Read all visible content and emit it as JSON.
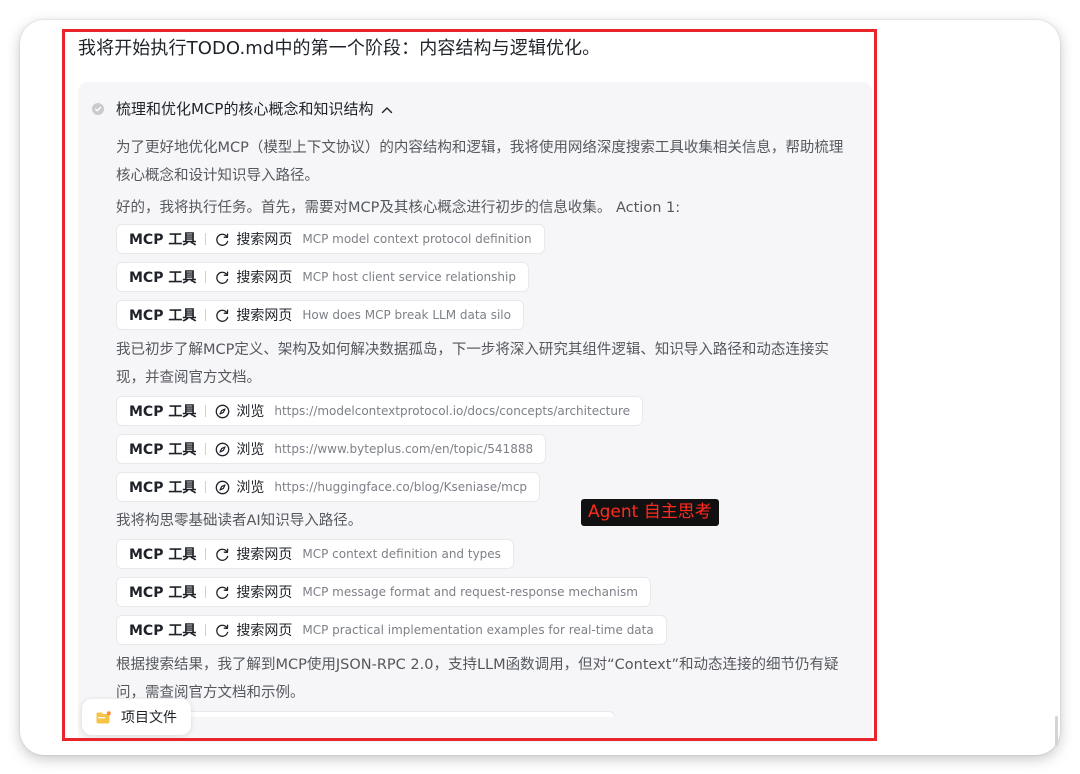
{
  "intro": "我将开始执行TODO.md中的第一个阶段：内容结构与逻辑优化。",
  "section": {
    "title": "梳理和优化MCP的核心概念和知识结构"
  },
  "paragraphs": {
    "p1": "为了更好地优化MCP（模型上下文协议）的内容结构和逻辑，我将使用网络深度搜索工具收集相关信息，帮助梳理核心概念和设计知识导入路径。",
    "p2": "好的，我将执行任务。首先，需要对MCP及其核心概念进行初步的信息收集。 Action 1:",
    "p3": "我已初步了解MCP定义、架构及如何解决数据孤岛，下一步将深入研究其组件逻辑、知识导入路径和动态连接实现，并查阅官方文档。",
    "p4": "我将构思零基础读者AI知识导入路径。",
    "p5": "根据搜索结果，我了解到MCP使用JSON-RPC 2.0，支持LLM函数调用，但对“Context”和动态连接的细节仍有疑问，需查阅官方文档和示例。"
  },
  "chips": {
    "source": "MCP 工具",
    "search_action": "搜索网页",
    "browse_action": "浏览",
    "search_icon": "refresh-search-icon",
    "browse_icon": "compass-icon",
    "group1": [
      {
        "query": "MCP model context protocol definition"
      },
      {
        "query": "MCP host client service relationship"
      },
      {
        "query": "How does MCP break LLM data silo"
      }
    ],
    "group2": [
      {
        "query": "https://modelcontextprotocol.io/docs/concepts/architecture"
      },
      {
        "query": "https://www.byteplus.com/en/topic/541888"
      },
      {
        "query": "https://huggingface.co/blog/Kseniase/mcp"
      }
    ],
    "group3": [
      {
        "query": "MCP context definition and types"
      },
      {
        "query": "MCP message format and request-response mechanism"
      },
      {
        "query": "MCP practical implementation examples for real-time data"
      }
    ]
  },
  "annotation": {
    "label": "Agent 自主思考",
    "border_color": "#e8252b",
    "text_color": "#ff2a20"
  },
  "files_button": {
    "label": "项目文件",
    "icon": "folder-icon"
  }
}
